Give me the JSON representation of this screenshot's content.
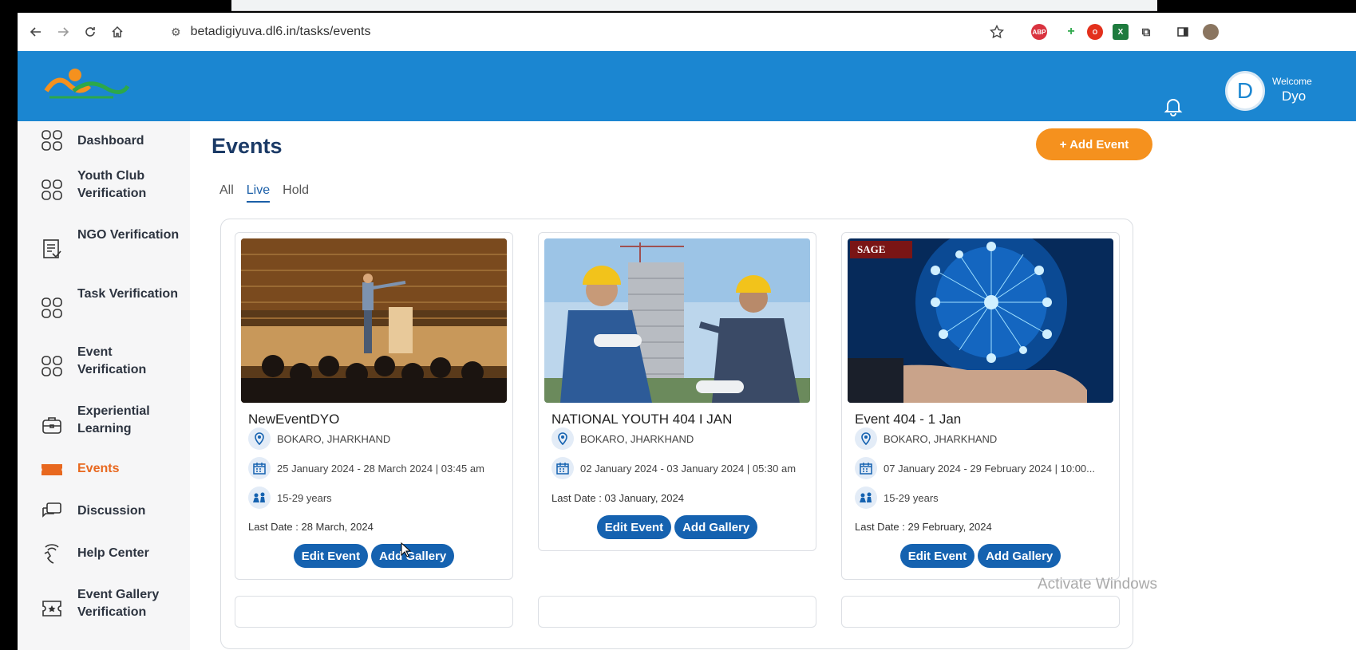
{
  "browser": {
    "url": "betadigiyuva.dl6.in/tasks/events",
    "extensions": [
      "abp-icon",
      "plus-icon",
      "opera-icon",
      "excel-icon",
      "puzzle-icon",
      "sidepanel-icon",
      "profile-icon"
    ]
  },
  "header": {
    "welcome_label": "Welcome",
    "user_name": "Dyo",
    "avatar_letter": "D",
    "color": "#1b86d1"
  },
  "sidebar": {
    "items": [
      {
        "label": "Dashboard",
        "icon": "grid-icon"
      },
      {
        "label": "Youth Club Verification",
        "icon": "grid-icon"
      },
      {
        "label": "NGO Verification",
        "icon": "document-check-icon"
      },
      {
        "label": "Task Verification",
        "icon": "grid-icon"
      },
      {
        "label": "Event Verification",
        "icon": "grid-icon"
      },
      {
        "label": "Experiential Learning",
        "icon": "briefcase-icon"
      },
      {
        "label": "Events",
        "icon": "ticket-icon",
        "active": true
      },
      {
        "label": "Discussion",
        "icon": "chat-icon"
      },
      {
        "label": "Help Center",
        "icon": "headset-icon"
      },
      {
        "label": "Event Gallery Verification",
        "icon": "gallery-icon"
      }
    ],
    "active_color": "#e8681f"
  },
  "main": {
    "title": "Events",
    "add_event_label": "+ Add Event",
    "tabs": [
      {
        "label": "All",
        "active": false
      },
      {
        "label": "Live",
        "active": true
      },
      {
        "label": "Hold",
        "active": false
      }
    ],
    "cards": [
      {
        "title": "NewEventDYO",
        "location": "BOKARO, JHARKHAND",
        "dates": "25 January 2024 - 28 March 2024 | 03:45 am",
        "age": "15-29 years",
        "last_date": "Last Date : 28 March, 2024",
        "edit_label": "Edit Event",
        "gallery_label": "Add Gallery",
        "image": "speaker-on-stage"
      },
      {
        "title": "NATIONAL YOUTH 404 I JAN",
        "location": "BOKARO, JHARKHAND",
        "dates": "02 January 2024 - 03 January 2024 | 05:30 am",
        "age": "",
        "last_date": "Last Date : 03 January, 2024",
        "edit_label": "Edit Event",
        "gallery_label": "Add Gallery",
        "image": "engineers-construction"
      },
      {
        "title": "Event 404 - 1 Jan",
        "location": "BOKARO, JHARKHAND",
        "dates": "07 January 2024 - 29 February 2024 | 10:00...",
        "age": "15-29 years",
        "last_date": "Last Date : 29 February, 2024",
        "edit_label": "Edit Event",
        "gallery_label": "Add Gallery",
        "image": "tech-network-globe",
        "image_text": "SAGE"
      }
    ],
    "button_color": "#1562b0",
    "accent_color": "#f5911e"
  },
  "watermark": "Activate Windows"
}
